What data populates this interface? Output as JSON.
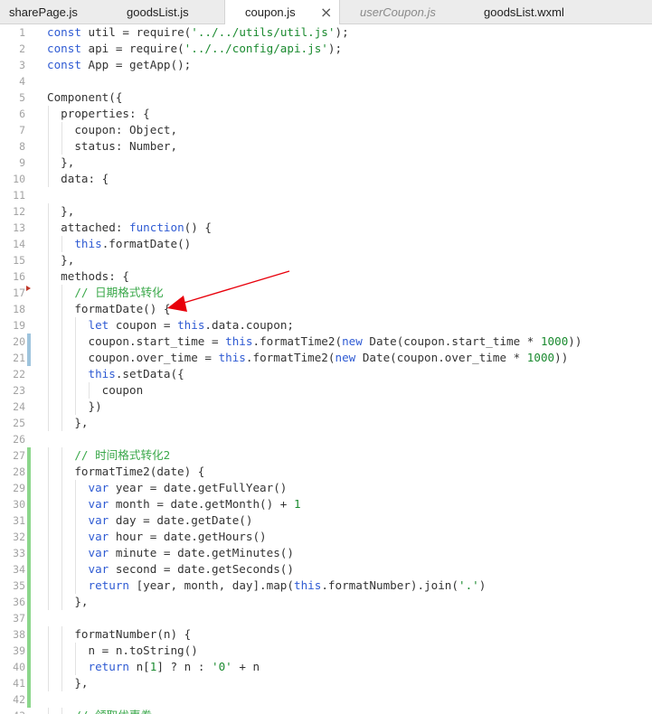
{
  "tabs": [
    {
      "label": "sharePage.js",
      "active": false,
      "preview": false
    },
    {
      "label": "goodsList.js",
      "active": false,
      "preview": false
    },
    {
      "label": "coupon.js",
      "active": true,
      "preview": false
    },
    {
      "label": "userCoupon.js",
      "active": false,
      "preview": true
    },
    {
      "label": "goodsList.wxml",
      "active": false,
      "preview": false
    }
  ],
  "close_glyph": "×",
  "colors": {
    "keyword": "#2f5bd3",
    "string": "#1a8a2f",
    "comment": "#3aa84a",
    "modified_marker": "#9ec4dd",
    "added_marker": "#8bd68b",
    "arrow": "#e8000b"
  },
  "markers": {
    "modified": [
      20,
      21
    ],
    "added_from": 27,
    "added_to": 42
  },
  "fold_line": 17,
  "lines": [
    "const util = require('../../utils/util.js');",
    "const api = require('../../config/api.js');",
    "const App = getApp();",
    "",
    "Component({",
    "  properties: {",
    "    coupon: Object,",
    "    status: Number,",
    "  },",
    "  data: {",
    "",
    "  },",
    "  attached: function() {",
    "    this.formatDate()",
    "  },",
    "  methods: {",
    "    // 日期格式转化",
    "    formatDate() {",
    "      let coupon = this.data.coupon;",
    "      coupon.start_time = this.formatTime2(new Date(coupon.start_time * 1000))",
    "      coupon.over_time = this.formatTime2(new Date(coupon.over_time * 1000))",
    "      this.setData({",
    "        coupon",
    "      })",
    "    },",
    "",
    "    // 时间格式转化2",
    "    formatTime2(date) {",
    "      var year = date.getFullYear()",
    "      var month = date.getMonth() + 1",
    "      var day = date.getDate()",
    "      var hour = date.getHours()",
    "      var minute = date.getMinutes()",
    "      var second = date.getSeconds()",
    "      return [year, month, day].map(this.formatNumber).join('.')",
    "    },",
    "",
    "    formatNumber(n) {",
    "      n = n.toString()",
    "      return n[1] ? n : '0' + n",
    "    },",
    "",
    "    // 领取优惠券"
  ]
}
